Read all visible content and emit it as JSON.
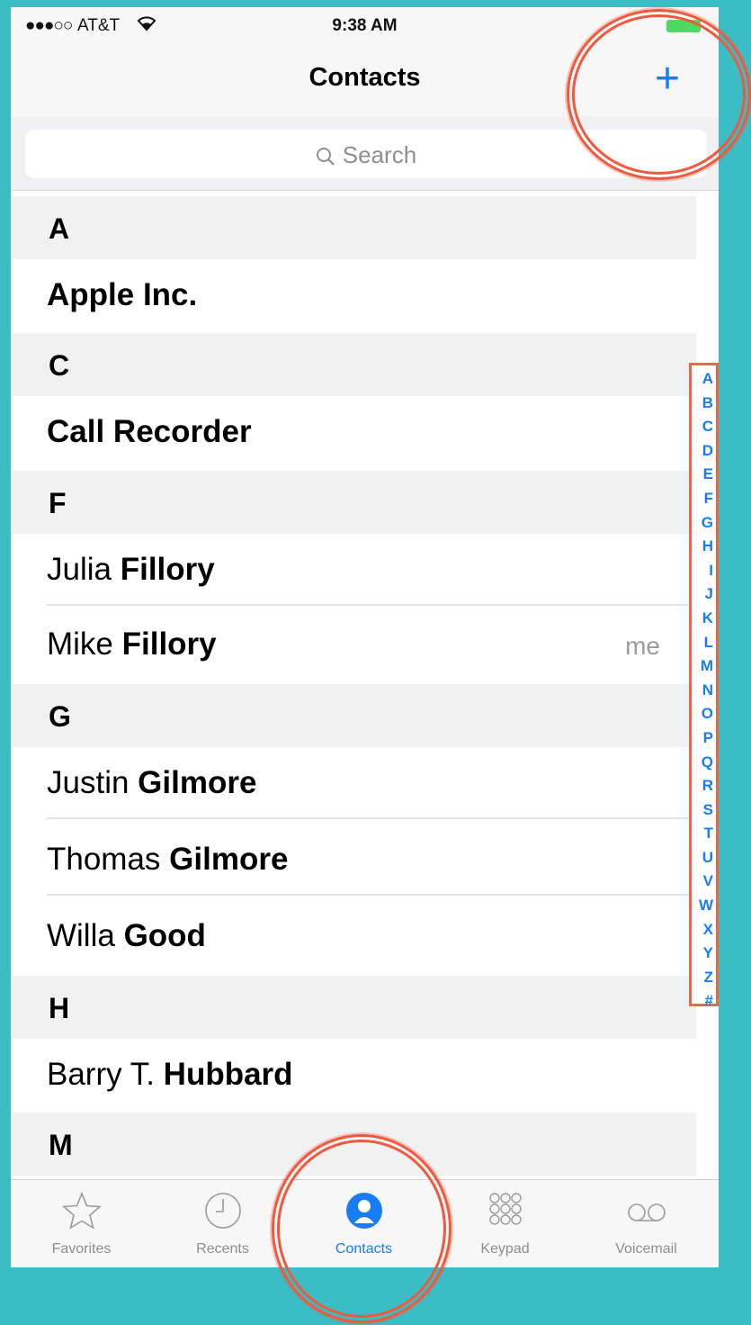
{
  "status_bar": {
    "signal": "●●●○○",
    "carrier": "AT&T",
    "time": "9:38 AM"
  },
  "nav": {
    "title": "Contacts",
    "add_label": "+"
  },
  "search": {
    "placeholder": "Search"
  },
  "sections": [
    {
      "letter": "A",
      "contacts": [
        {
          "first": "",
          "last": "Apple Inc.",
          "tag": ""
        }
      ]
    },
    {
      "letter": "C",
      "contacts": [
        {
          "first": "",
          "last": "Call Recorder",
          "tag": ""
        }
      ]
    },
    {
      "letter": "F",
      "contacts": [
        {
          "first": "Julia ",
          "last": "Fillory",
          "tag": ""
        },
        {
          "first": "Mike ",
          "last": "Fillory",
          "tag": "me"
        }
      ]
    },
    {
      "letter": "G",
      "contacts": [
        {
          "first": "Justin ",
          "last": "Gilmore",
          "tag": ""
        },
        {
          "first": "Thomas ",
          "last": "Gilmore",
          "tag": ""
        },
        {
          "first": "Willa ",
          "last": "Good",
          "tag": ""
        }
      ]
    },
    {
      "letter": "H",
      "contacts": [
        {
          "first": "Barry T. ",
          "last": "Hubbard",
          "tag": ""
        }
      ]
    },
    {
      "letter": "M",
      "contacts": []
    }
  ],
  "index_letters": [
    "A",
    "B",
    "C",
    "D",
    "E",
    "F",
    "G",
    "H",
    "I",
    "J",
    "K",
    "L",
    "M",
    "N",
    "O",
    "P",
    "Q",
    "R",
    "S",
    "T",
    "U",
    "V",
    "W",
    "X",
    "Y",
    "Z",
    "#"
  ],
  "tabs": [
    {
      "label": "Favorites",
      "icon": "star-icon",
      "active": false
    },
    {
      "label": "Recents",
      "icon": "clock-icon",
      "active": false
    },
    {
      "label": "Contacts",
      "icon": "person-icon",
      "active": true
    },
    {
      "label": "Keypad",
      "icon": "keypad-icon",
      "active": false
    },
    {
      "label": "Voicemail",
      "icon": "voicemail-icon",
      "active": false
    }
  ],
  "colors": {
    "accent": "#1a7cf5",
    "annotation": "#ee5a3d",
    "background": "#3bbdc6"
  }
}
